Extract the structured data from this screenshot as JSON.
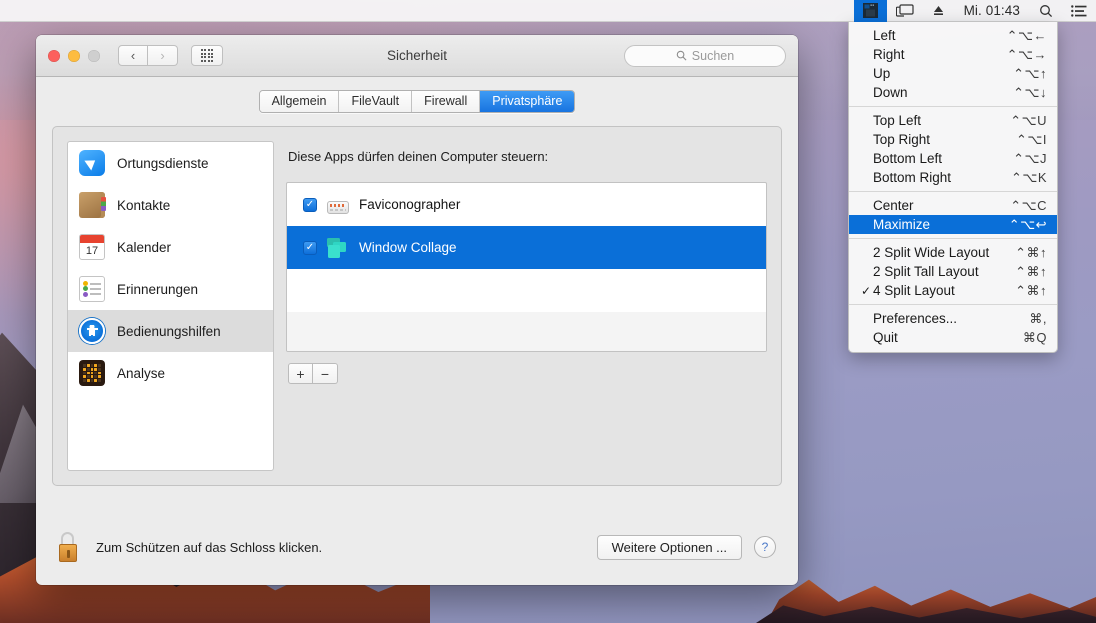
{
  "menubar": {
    "app_icon": "window-collage-icon",
    "display_icon": "airplay-display-icon",
    "eject_icon": "eject-icon",
    "clock": "Mi. 01:43",
    "search_icon": "spotlight-search-icon",
    "list_icon": "notification-center-icon"
  },
  "window": {
    "title": "Sicherheit",
    "back_label": "‹",
    "forward_label": "›",
    "grid_icon": "show-all-grid-icon",
    "search_placeholder": "Suchen",
    "search_value": "",
    "search_icon": "search-icon",
    "tabs": [
      {
        "label": "Allgemein",
        "selected": false
      },
      {
        "label": "FileVault",
        "selected": false
      },
      {
        "label": "Firewall",
        "selected": false
      },
      {
        "label": "Privatsphäre",
        "selected": true
      }
    ],
    "sidebar": [
      {
        "label": "Ortungsdienste",
        "icon": "location-services-icon",
        "selected": false
      },
      {
        "label": "Kontakte",
        "icon": "contacts-icon",
        "selected": false
      },
      {
        "label": "Kalender",
        "icon": "calendar-icon",
        "selected": false,
        "day": "17"
      },
      {
        "label": "Erinnerungen",
        "icon": "reminders-icon",
        "selected": false
      },
      {
        "label": "Bedienungshilfen",
        "icon": "accessibility-icon",
        "selected": true
      },
      {
        "label": "Analyse",
        "icon": "analytics-icon",
        "selected": false
      }
    ],
    "content": {
      "label": "Diese Apps dürfen deinen Computer steuern:",
      "apps": [
        {
          "name": "Faviconographer",
          "icon": "faviconographer-icon",
          "checked": true,
          "selected": false
        },
        {
          "name": "Window Collage",
          "icon": "window-collage-icon",
          "checked": true,
          "selected": true
        }
      ],
      "add_label": "+",
      "remove_label": "−"
    },
    "footer": {
      "lock_icon": "unlocked-padlock-icon",
      "lock_text": "Zum Schützen auf das Schloss klicken.",
      "options_button": "Weitere Optionen ...",
      "help_button": "?"
    }
  },
  "menu": {
    "groups": [
      {
        "items": [
          {
            "label": "Left",
            "shortcut": "⌃⌥←",
            "selected": false,
            "checked": false
          },
          {
            "label": "Right",
            "shortcut": "⌃⌥→",
            "selected": false,
            "checked": false
          },
          {
            "label": "Up",
            "shortcut": "⌃⌥↑",
            "selected": false,
            "checked": false
          },
          {
            "label": "Down",
            "shortcut": "⌃⌥↓",
            "selected": false,
            "checked": false
          }
        ]
      },
      {
        "items": [
          {
            "label": "Top Left",
            "shortcut": "⌃⌥U",
            "selected": false,
            "checked": false
          },
          {
            "label": "Top Right",
            "shortcut": "⌃⌥I",
            "selected": false,
            "checked": false
          },
          {
            "label": "Bottom Left",
            "shortcut": "⌃⌥J",
            "selected": false,
            "checked": false
          },
          {
            "label": "Bottom Right",
            "shortcut": "⌃⌥K",
            "selected": false,
            "checked": false
          }
        ]
      },
      {
        "items": [
          {
            "label": "Center",
            "shortcut": "⌃⌥C",
            "selected": false,
            "checked": false
          },
          {
            "label": "Maximize",
            "shortcut": "⌃⌥↩",
            "selected": true,
            "checked": false
          }
        ]
      },
      {
        "items": [
          {
            "label": "2 Split Wide Layout",
            "shortcut": "⌃⌘↑",
            "selected": false,
            "checked": false
          },
          {
            "label": "2 Split Tall Layout",
            "shortcut": "⌃⌘↑",
            "selected": false,
            "checked": false
          },
          {
            "label": "4 Split Layout",
            "shortcut": "⌃⌘↑",
            "selected": false,
            "checked": true
          }
        ]
      },
      {
        "items": [
          {
            "label": "Preferences...",
            "shortcut": "⌘,",
            "selected": false,
            "checked": false
          },
          {
            "label": "Quit",
            "shortcut": "⌘Q",
            "selected": false,
            "checked": false
          }
        ]
      }
    ]
  },
  "colors": {
    "accent_blue": "#0a6fd8",
    "tab_selected": "#1874e0",
    "window_bg": "#ececec",
    "lock_gold": "#d8912f"
  }
}
